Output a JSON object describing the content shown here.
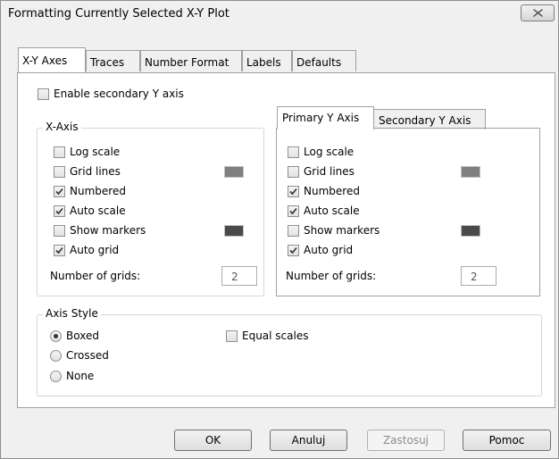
{
  "window": {
    "title": "Formatting Currently Selected X-Y Plot"
  },
  "tabs": [
    "X-Y Axes",
    "Traces",
    "Number Format",
    "Labels",
    "Defaults"
  ],
  "enable_secondary": {
    "label": "Enable secondary Y axis",
    "checked": false
  },
  "x_axis": {
    "title": "X-Axis",
    "options": [
      {
        "label": "Log scale",
        "checked": false
      },
      {
        "label": "Grid lines",
        "checked": false
      },
      {
        "label": "Numbered",
        "checked": true
      },
      {
        "label": "Auto scale",
        "checked": true
      },
      {
        "label": "Show markers",
        "checked": false
      },
      {
        "label": "Auto grid",
        "checked": true
      }
    ],
    "grid_color": "#808080",
    "marker_color": "#4a4a4a",
    "num_grids_label": "Number of grids:",
    "num_grids_value": "2"
  },
  "y_tabs": [
    "Primary Y Axis",
    "Secondary Y Axis"
  ],
  "y_axis": {
    "options": [
      {
        "label": "Log scale",
        "checked": false
      },
      {
        "label": "Grid lines",
        "checked": false
      },
      {
        "label": "Numbered",
        "checked": true
      },
      {
        "label": "Auto scale",
        "checked": true
      },
      {
        "label": "Show markers",
        "checked": false
      },
      {
        "label": "Auto grid",
        "checked": true
      }
    ],
    "grid_color": "#808080",
    "marker_color": "#4a4a4a",
    "num_grids_label": "Number of grids:",
    "num_grids_value": "2"
  },
  "axis_style": {
    "title": "Axis Style",
    "options": [
      {
        "label": "Boxed",
        "selected": true
      },
      {
        "label": "Crossed",
        "selected": false
      },
      {
        "label": "None",
        "selected": false
      }
    ],
    "equal_scales": {
      "label": "Equal scales",
      "checked": false
    }
  },
  "buttons": {
    "ok": "OK",
    "cancel": "Anuluj",
    "apply": "Zastosuj",
    "help": "Pomoc"
  }
}
